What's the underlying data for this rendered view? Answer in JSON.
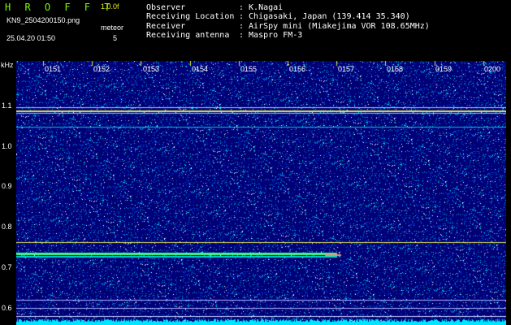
{
  "app_title": "H R O F F T",
  "version": "1.0.0f",
  "filename": "KN9_2504200150.png",
  "mode": "meteor",
  "count": "5",
  "datetime": "25.04.20 01:50",
  "info": {
    "observer_label": "Observer",
    "observer_value": ": K.Nagai",
    "location_label": "Receiving Location",
    "location_value": ": Chigasaki, Japan (139.414 35.340)",
    "receiver_label": "Receiver",
    "receiver_value": ": AirSpy mini (Miakejima VOR 108.65MHz)",
    "antenna_label": "Receiving antenna",
    "antenna_value": ": Maspro FM-3"
  },
  "y_unit": "kHz",
  "time_ticks": [
    "0151",
    "0152",
    "0153",
    "0154",
    "0155",
    "0156",
    "0157",
    "0158",
    "0159",
    "0200"
  ],
  "freq_ticks": [
    "1.1",
    "1.0",
    "0.9",
    "0.8",
    "0.7",
    "0.6"
  ],
  "colors": {
    "background": "#000000",
    "title": "#7cfc00",
    "noise_floor": "#000064",
    "bottom_band": "#00e5ff",
    "signal_line": "#e6e650"
  }
}
